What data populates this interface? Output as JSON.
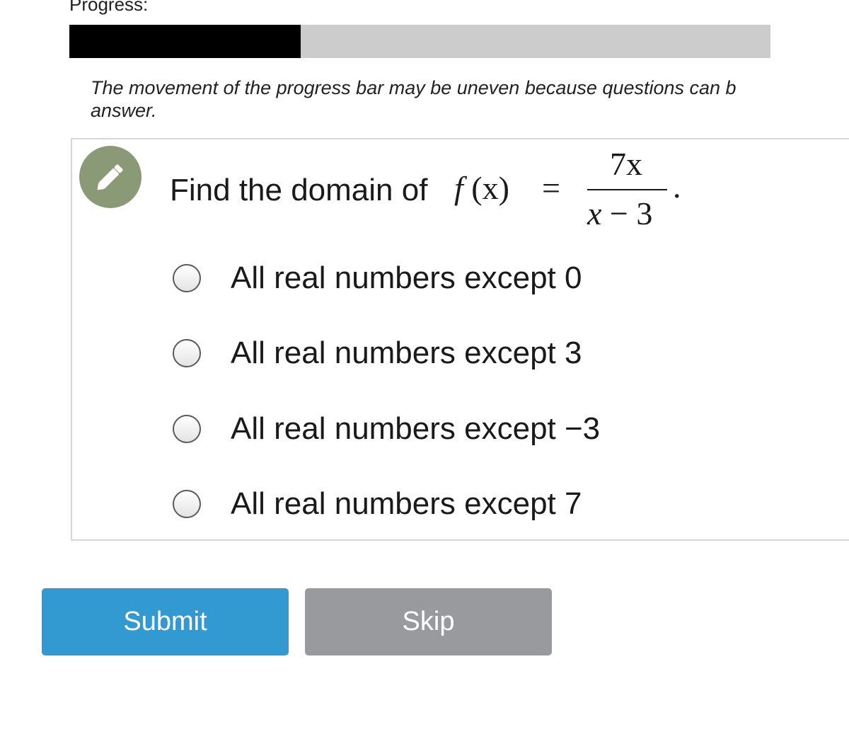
{
  "progress": {
    "label": "Progress:",
    "fraction": 0.33,
    "fill_color": "#000000",
    "track_color": "#cccccc",
    "note": "The movement of the progress bar may be uneven because questions can b",
    "note_line2": "answer."
  },
  "question": {
    "icon": "pencil-icon",
    "icon_bg_color": "#8a9a77",
    "prompt": "Find the domain of",
    "func_f": "f",
    "func_arg": "(x)",
    "equals": "=",
    "numerator": "7x",
    "denominator_var": "x",
    "denominator_rest": " − 3",
    "period": "."
  },
  "options": [
    {
      "label": "All real numbers except 0"
    },
    {
      "label": "All real numbers except 3"
    },
    {
      "label": "All real numbers except −3"
    },
    {
      "label": "All real numbers except 7"
    }
  ],
  "buttons": {
    "submit_label": "Submit",
    "submit_color": "#3399d1",
    "skip_label": "Skip",
    "skip_color": "#999a9d"
  }
}
